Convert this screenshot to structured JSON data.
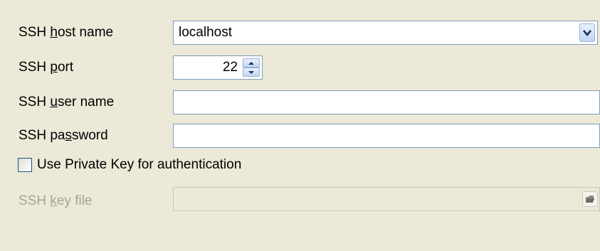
{
  "form": {
    "host": {
      "pre": "SSH ",
      "key": "h",
      "post": "ost name",
      "value": "localhost"
    },
    "port": {
      "pre": "SSH ",
      "key": "p",
      "post": "ort",
      "value": "22"
    },
    "user": {
      "pre": "SSH ",
      "key": "u",
      "post": "ser name",
      "value": ""
    },
    "password": {
      "pre": "SSH pa",
      "key": "s",
      "post": "sword",
      "value": ""
    },
    "use_private_key": {
      "label": "Use Private Key for authentication",
      "checked": false
    },
    "key_file": {
      "pre": "SSH ",
      "key": "k",
      "post": "ey file",
      "value": "",
      "enabled": false
    }
  },
  "icons": {
    "combo": "chevron-down-icon",
    "spin_up": "spin-up-icon",
    "spin_down": "spin-down-icon",
    "browse": "folder-open-icon"
  },
  "colors": {
    "background": "#ece9d8",
    "field_border": "#7f9db9",
    "disabled_text": "#a5a39a",
    "checkbox_border": "#1c5180"
  }
}
